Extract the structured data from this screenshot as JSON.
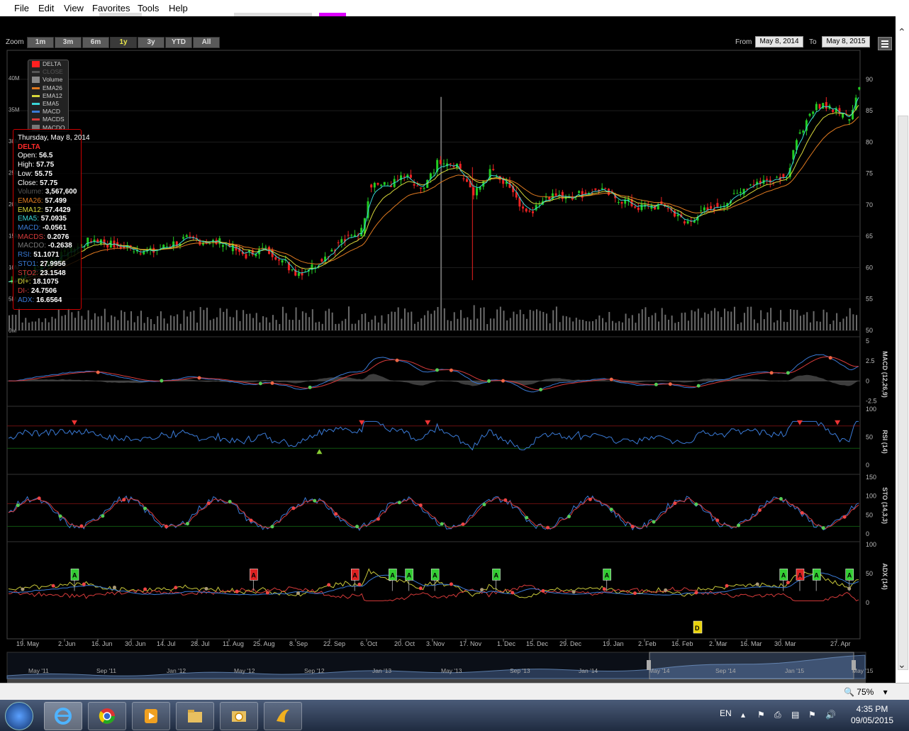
{
  "menu": {
    "items": [
      "File",
      "Edit",
      "View",
      "Favorites",
      "Tools",
      "Help"
    ]
  },
  "toolbar": {
    "zoom_label": "Zoom",
    "zoom_buttons": [
      "1m",
      "3m",
      "6m",
      "1y",
      "3y",
      "YTD",
      "All"
    ],
    "zoom_active": "1y",
    "from_label": "From",
    "from_value": "May 8, 2014",
    "to_label": "To",
    "to_value": "May 8, 2015"
  },
  "legend": {
    "items": [
      {
        "name": "DELTA",
        "color": "#ff2020",
        "kind": "box"
      },
      {
        "name": "CLOSE",
        "color": "#555555",
        "kind": "line"
      },
      {
        "name": "Volume",
        "color": "#888888",
        "kind": "box"
      },
      {
        "name": "EMA26",
        "color": "#e07a20",
        "kind": "line"
      },
      {
        "name": "EMA12",
        "color": "#d7d73a",
        "kind": "line"
      },
      {
        "name": "EMA5",
        "color": "#3ad6d6",
        "kind": "line"
      },
      {
        "name": "MACD",
        "color": "#3a7ad6",
        "kind": "line"
      },
      {
        "name": "MACDS",
        "color": "#d63a3a",
        "kind": "line"
      },
      {
        "name": "MACDO",
        "color": "#777777",
        "kind": "box"
      }
    ]
  },
  "tooltip": {
    "date": "Thursday, May 8, 2014",
    "symbol": "DELTA",
    "rows": [
      {
        "label": "Open",
        "value": "56.5",
        "color": "#ffffff"
      },
      {
        "label": "High",
        "value": "57.75",
        "color": "#ffffff"
      },
      {
        "label": "Low",
        "value": "55.75",
        "color": "#ffffff"
      },
      {
        "label": "Close",
        "value": "57.75",
        "color": "#ffffff"
      },
      {
        "label": "Volume",
        "value": "3,567,600",
        "color": "#555555"
      },
      {
        "label": "EMA26",
        "value": "57.499",
        "color": "#e07a20"
      },
      {
        "label": "EMA12",
        "value": "57.4429",
        "color": "#d7d73a"
      },
      {
        "label": "EMA5",
        "value": "57.0935",
        "color": "#3ad6d6"
      },
      {
        "label": "MACD",
        "value": "-0.0561",
        "color": "#3a7ad6"
      },
      {
        "label": "MACDS",
        "value": "0.2076",
        "color": "#d63a3a"
      },
      {
        "label": "MACDO",
        "value": "-0.2638",
        "color": "#777777"
      },
      {
        "label": "RSI",
        "value": "51.1071",
        "color": "#3a7ad6"
      },
      {
        "label": "STO1",
        "value": "27.9956",
        "color": "#3a7ad6"
      },
      {
        "label": "STO2",
        "value": "23.1548",
        "color": "#d63a3a"
      },
      {
        "label": "DI+",
        "value": "18.1075",
        "color": "#d7d73a"
      },
      {
        "label": "DI-",
        "value": "24.7506",
        "color": "#d63a3a"
      },
      {
        "label": "ADX",
        "value": "16.6564",
        "color": "#3a7ad6"
      }
    ]
  },
  "chart_data": {
    "type": "candlestick",
    "symbol": "DELTA",
    "price_axis": {
      "ticks": [
        50,
        55,
        60,
        65,
        70,
        75,
        80,
        85,
        90
      ],
      "range": [
        50,
        91
      ]
    },
    "volume_axis": {
      "labels": [
        "0M",
        "5M",
        "10M",
        "15M",
        "20M",
        "25M",
        "30M",
        "35M",
        "40M"
      ],
      "range_millions": [
        0,
        40
      ]
    },
    "x_ticks": [
      "19. May",
      "2. Jun",
      "16. Jun",
      "30. Jun",
      "14. Jul",
      "28. Jul",
      "11. Aug",
      "25. Aug",
      "8. Sep",
      "22. Sep",
      "6. Oct",
      "20. Oct",
      "3. Nov",
      "17. Nov",
      "1. Dec",
      "15. Dec",
      "29. Dec",
      "19. Jan",
      "2. Feb",
      "16. Feb",
      "2. Mar",
      "16. Mar",
      "30. Mar",
      "27. Apr"
    ],
    "price_anchors": [
      {
        "d": 0,
        "c": 57.75
      },
      {
        "d": 10,
        "c": 59.5
      },
      {
        "d": 20,
        "c": 61.5
      },
      {
        "d": 35,
        "c": 64.5
      },
      {
        "d": 45,
        "c": 63.5
      },
      {
        "d": 60,
        "c": 62.5
      },
      {
        "d": 75,
        "c": 64.5
      },
      {
        "d": 90,
        "c": 64.0
      },
      {
        "d": 100,
        "c": 62.0
      },
      {
        "d": 108,
        "c": 63.0
      },
      {
        "d": 115,
        "c": 61.5
      },
      {
        "d": 122,
        "c": 59.0
      },
      {
        "d": 130,
        "c": 60.5
      },
      {
        "d": 140,
        "c": 64.0
      },
      {
        "d": 150,
        "c": 66.0
      },
      {
        "d": 153,
        "c": 73.5
      },
      {
        "d": 160,
        "c": 73.0
      },
      {
        "d": 168,
        "c": 74.5
      },
      {
        "d": 175,
        "c": 72.0
      },
      {
        "d": 182,
        "c": 76.5
      },
      {
        "d": 190,
        "c": 76.0
      },
      {
        "d": 197,
        "c": 72.0
      },
      {
        "d": 205,
        "c": 75.5
      },
      {
        "d": 212,
        "c": 73.0
      },
      {
        "d": 220,
        "c": 68.5
      },
      {
        "d": 228,
        "c": 71.5
      },
      {
        "d": 240,
        "c": 71.5
      },
      {
        "d": 250,
        "c": 72.5
      },
      {
        "d": 258,
        "c": 71.0
      },
      {
        "d": 268,
        "c": 69.5
      },
      {
        "d": 278,
        "c": 70.0
      },
      {
        "d": 287,
        "c": 67.0
      },
      {
        "d": 295,
        "c": 69.0
      },
      {
        "d": 305,
        "c": 70.5
      },
      {
        "d": 315,
        "c": 73.5
      },
      {
        "d": 322,
        "c": 74.0
      },
      {
        "d": 330,
        "c": 75.0
      },
      {
        "d": 336,
        "c": 82.0
      },
      {
        "d": 345,
        "c": 86.5
      },
      {
        "d": 352,
        "c": 84.5
      },
      {
        "d": 357,
        "c": 84.0
      },
      {
        "d": 360,
        "c": 89.0
      }
    ],
    "volume_spikes": [
      {
        "d": 156,
        "millions": 18
      },
      {
        "d": 166,
        "millions": 9
      },
      {
        "d": 183,
        "millions": 37
      },
      {
        "d": 197,
        "millions": 4
      }
    ],
    "macd_panel": {
      "label": "MACD (12,26,9)",
      "ticks": [
        5,
        2.5,
        0,
        -2.5
      ],
      "range": [
        -3,
        5
      ]
    },
    "rsi_panel": {
      "label": "RSI (14)",
      "ticks": [
        100,
        50,
        0
      ],
      "range": [
        0,
        100
      ],
      "levels": [
        70,
        30
      ]
    },
    "sto_panel": {
      "label": "STO (14,3,3)",
      "ticks": [
        150,
        100,
        50,
        0
      ],
      "range": [
        0,
        150
      ],
      "levels": [
        80,
        20
      ]
    },
    "adx_panel": {
      "label": "ADX (14)",
      "ticks": [
        100,
        50,
        0
      ],
      "range": [
        -10,
        100
      ]
    },
    "adx_flags": [
      {
        "d": 28,
        "label": "A",
        "color": "green"
      },
      {
        "d": 104,
        "label": "A",
        "color": "red"
      },
      {
        "d": 147,
        "label": "A",
        "color": "red"
      },
      {
        "d": 163,
        "label": "A",
        "color": "green"
      },
      {
        "d": 170,
        "label": "A",
        "color": "green"
      },
      {
        "d": 181,
        "label": "A",
        "color": "green"
      },
      {
        "d": 207,
        "label": "A",
        "color": "green"
      },
      {
        "d": 254,
        "label": "A",
        "color": "green"
      },
      {
        "d": 329,
        "label": "A",
        "color": "green"
      },
      {
        "d": 336,
        "label": "A",
        "color": "red"
      },
      {
        "d": 343,
        "label": "A",
        "color": "green"
      },
      {
        "d": 357,
        "label": "A",
        "color": "green"
      }
    ],
    "dividend_flag": {
      "label": "D",
      "near": "23. Feb"
    },
    "navigator": {
      "labels": [
        "May '11",
        "Sep '11",
        "Jan '12",
        "May '12",
        "Sep '12",
        "Jan '13",
        "May '13",
        "Sep '13",
        "Jan '14",
        "May '14",
        "Sep '14",
        "Jan '15",
        "May '15"
      ]
    }
  },
  "status": {
    "zoom_label": "75%"
  },
  "taskbar": {
    "lang": "EN",
    "time": "4:35 PM",
    "date": "09/05/2015"
  }
}
